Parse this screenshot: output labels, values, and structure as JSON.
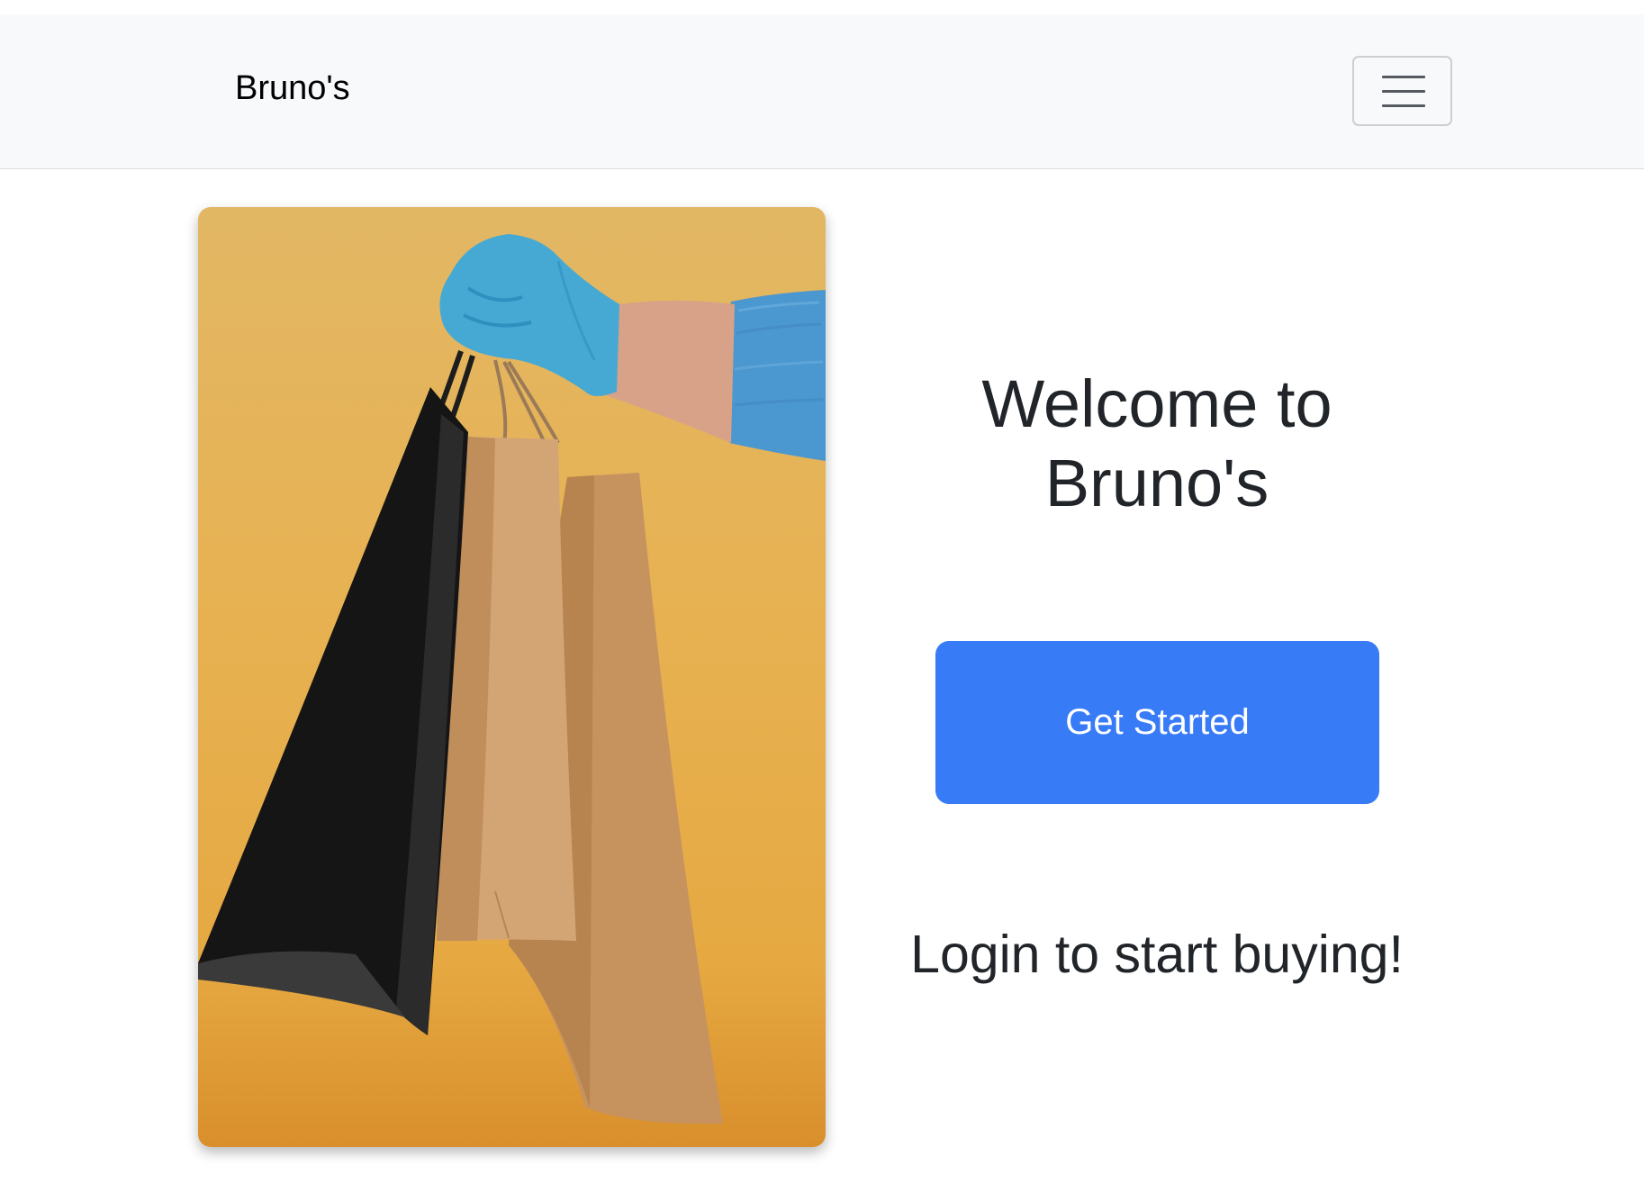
{
  "navbar": {
    "brand": "Bruno's",
    "toggle_icon": "hamburger-menu-icon"
  },
  "hero": {
    "image_subject": "gloved-hand-holding-shopping-bags",
    "background_color": "#e6ad48",
    "glove_color": "#46a9d4",
    "sleeve_color": "#4b97cf"
  },
  "main": {
    "welcome_title": "Welcome to Bruno's",
    "cta_label": "Get Started",
    "login_message": "Login to start buying!"
  },
  "colors": {
    "navbar_bg": "#f8f9fa",
    "primary": "#377bf6",
    "text": "#212529"
  }
}
